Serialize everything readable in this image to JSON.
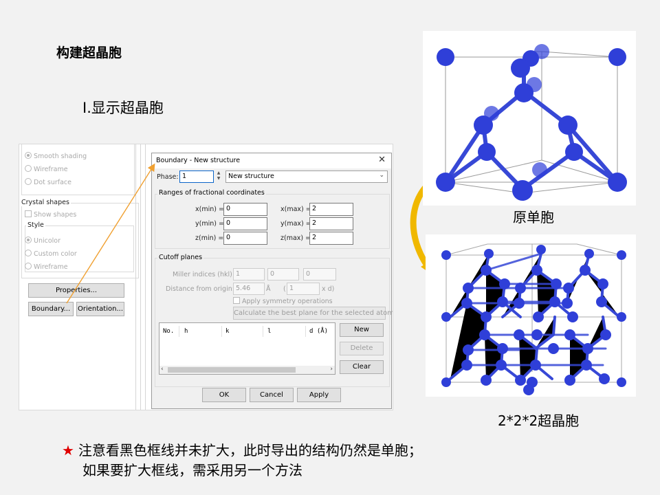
{
  "slide": {
    "title": "构建超晶胞",
    "subtitle": "Ⅰ.显示超晶胞",
    "caption_unit": "原单胞",
    "caption_super": "2*2*2超晶胞",
    "note_line1": "注意看黑色框线并未扩大，此时导出的结构仍然是单胞；",
    "note_line2": "如果要扩大框线，需采用另一个方法",
    "star": "★"
  },
  "left_panel": {
    "shading_options": [
      "Smooth shading",
      "Wireframe",
      "Dot surface"
    ],
    "crystal_group": "Crystal shapes",
    "show_shapes": "Show shapes",
    "style_group": "Style",
    "style_options": [
      "Unicolor",
      "Custom color",
      "Wireframe"
    ],
    "properties_button": "Properties...",
    "boundary_button": "Boundary...",
    "orientation_button": "Orientation..."
  },
  "dialog": {
    "title": "Boundary - New structure",
    "close_glyph": "✕",
    "phase_label": "Phase:",
    "phase_value": "1",
    "structure_select": "New structure",
    "ranges_group": "Ranges of fractional coordinates",
    "xmin_label": "x(min) =",
    "xmin": "0",
    "ymin_label": "y(min) =",
    "ymin": "0",
    "zmin_label": "z(min) =",
    "zmin": "0",
    "xmax_label": "x(max) =",
    "xmax": "2",
    "ymax_label": "y(max) =",
    "ymax": "2",
    "zmax_label": "z(max) =",
    "zmax": "2",
    "cutoff_group": "Cutoff planes",
    "miller_label": "Miller indices (hkl):",
    "miller_h": "1",
    "miller_k": "0",
    "miller_l": "0",
    "distance_label": "Distance from origin:",
    "distance_value": "5.46",
    "distance_unit": "Å",
    "paren_open": "(",
    "d_factor": "1",
    "d_suffix": "x d)",
    "symmetry_label": "Apply symmetry operations",
    "calc_button": "Calculate the best plane for the selected atoms",
    "table_columns": [
      "No.",
      "h",
      "k",
      "l",
      "d (Å)"
    ],
    "new_button": "New",
    "delete_button": "Delete",
    "clear_button": "Clear",
    "ok_button": "OK",
    "cancel_button": "Cancel",
    "apply_button": "Apply"
  },
  "colors": {
    "atom": "#2f3fd8",
    "bond": "#3748d6",
    "arrow_orange": "#f0a030",
    "arrow_gold": "#f0b800",
    "star": "#e00000"
  }
}
